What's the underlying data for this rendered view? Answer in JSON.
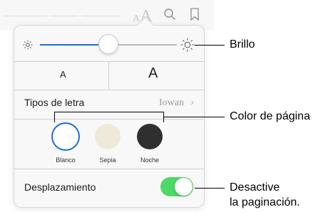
{
  "toolbar": {
    "text_size_icon": "text-size-icon",
    "search_icon": "search-icon",
    "bookmark_icon": "bookmark-icon"
  },
  "brightness": {
    "level": 0.45,
    "min_icon": "sun-small-icon",
    "max_icon": "sun-large-icon"
  },
  "font_size": {
    "smaller_label": "A",
    "larger_label": "A"
  },
  "font_row": {
    "label": "Tipos de letra",
    "value": "Iowan"
  },
  "themes": [
    {
      "label": "Blanco",
      "color": "#ffffff",
      "selected": true
    },
    {
      "label": "Sepia",
      "color": "#efe9d9",
      "selected": false
    },
    {
      "label": "Noche",
      "color": "#2f2f2f",
      "selected": false
    }
  ],
  "scroll_row": {
    "label": "Desplazamiento",
    "toggle_on": true
  },
  "callouts": {
    "brightness": "Brillo",
    "page_color": "Color de página",
    "scroll_line1": "Desactive",
    "scroll_line2": "la paginación."
  },
  "colors": {
    "accent": "#1b6ce0",
    "toggle_on": "#4cd964"
  }
}
